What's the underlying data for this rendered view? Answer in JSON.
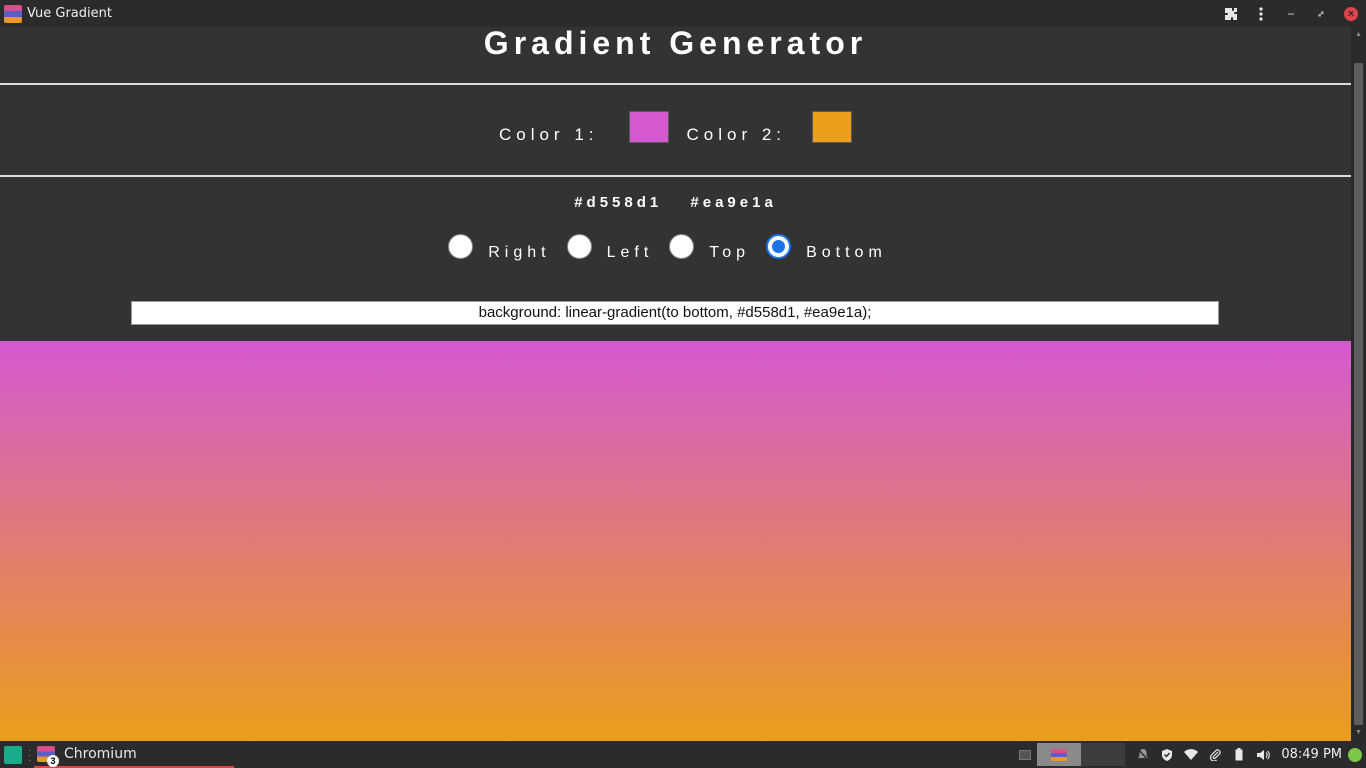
{
  "window": {
    "title": "Vue Gradient",
    "icons": [
      "extensions-icon",
      "menu-kebab-icon",
      "minimize-icon",
      "restore-icon",
      "close-icon"
    ]
  },
  "page": {
    "heading": "Gradient Generator",
    "color1_label": "Color 1:",
    "color2_label": "Color 2:",
    "color1": "#d558d1",
    "color2": "#ea9e1a",
    "hex1": "#d558d1",
    "hex2": "#ea9e1a",
    "directions": [
      {
        "label": "Right",
        "checked": false
      },
      {
        "label": "Left",
        "checked": false
      },
      {
        "label": "Top",
        "checked": false
      },
      {
        "label": "Bottom",
        "checked": true
      }
    ],
    "css_output": "background: linear-gradient(to bottom, #d558d1, #ea9e1a);"
  },
  "taskbar": {
    "task_label": "Chromium",
    "task_badge": "3",
    "clock": "08:49 PM"
  },
  "colors": {
    "accent_radio": "#1a73e8",
    "page_bg": "#333333",
    "close_button": "#e0434a"
  }
}
